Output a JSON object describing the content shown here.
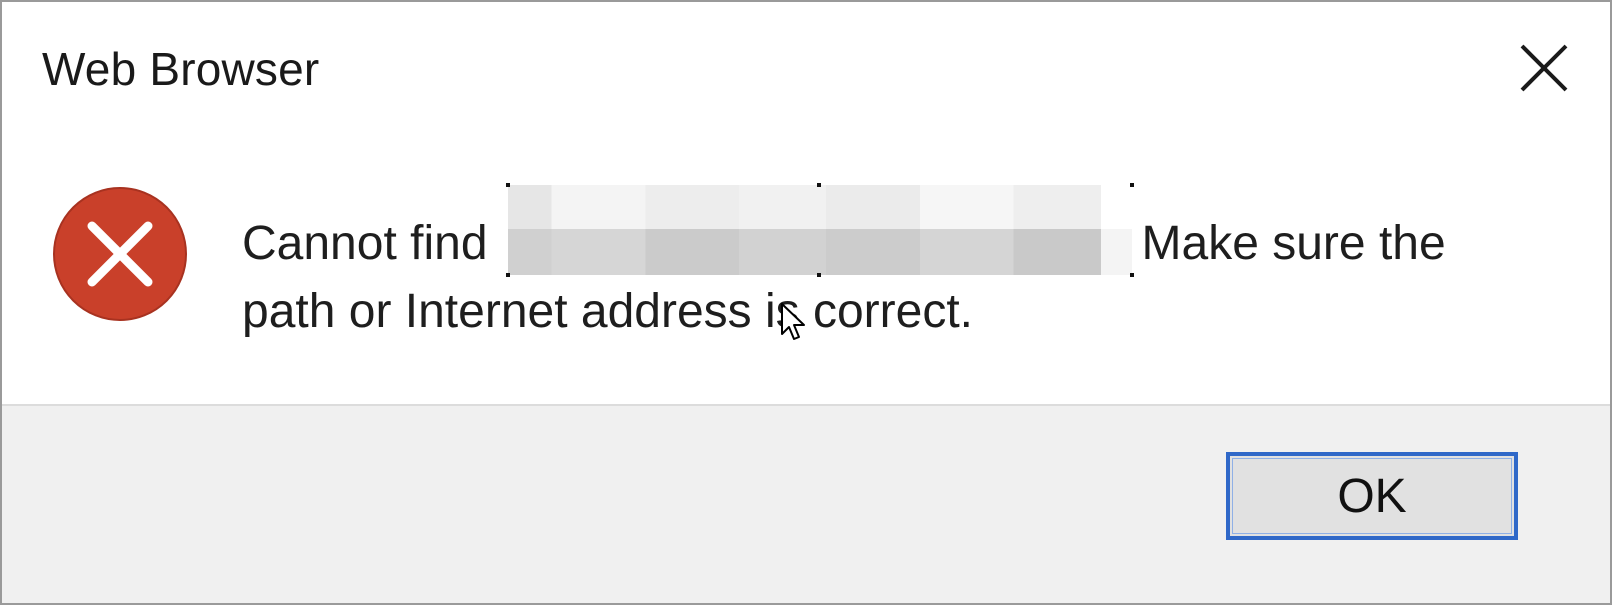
{
  "window": {
    "title": "Web Browser",
    "close_icon": "close-icon"
  },
  "message": {
    "icon": "error-icon",
    "icon_color": "#c9402a",
    "prefix": "Cannot find",
    "suffix": "Make sure the",
    "line2": "path or Internet address is correct."
  },
  "buttons": {
    "ok_label": "OK",
    "ok_border_color": "#2f68c8"
  }
}
